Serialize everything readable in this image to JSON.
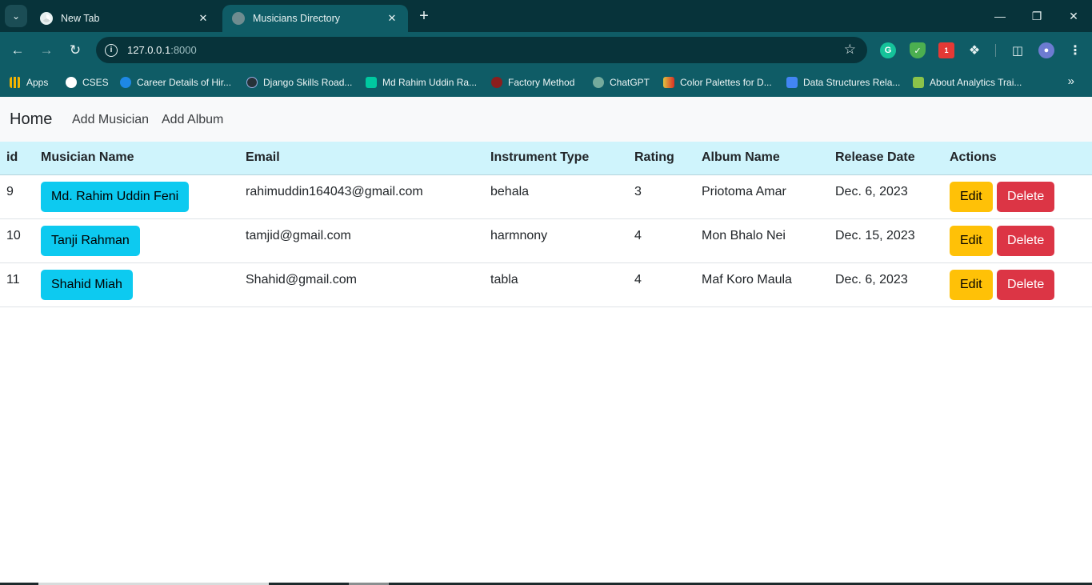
{
  "browser": {
    "tabs": [
      {
        "title": "New Tab",
        "active": false
      },
      {
        "title": "Musicians Directory",
        "active": true
      }
    ],
    "url_host": "127.0.0.1",
    "url_port": ":8000",
    "bookmarks": [
      {
        "label": "Apps",
        "icon_color": "#f4b400"
      },
      {
        "label": "CSES",
        "icon_color": "#ffffff"
      },
      {
        "label": "Career Details of Hir...",
        "icon_color": "#1e88e5"
      },
      {
        "label": "Django Skills Road...",
        "icon_color": "#263238"
      },
      {
        "label": "Md Rahim Uddin Ra...",
        "icon_color": "#00c8a0"
      },
      {
        "label": "Factory Method",
        "icon_color": "#8b1e1e"
      },
      {
        "label": "ChatGPT",
        "icon_color": "#74aa9c"
      },
      {
        "label": "Color Palettes for D...",
        "icon_color": "#e0c240"
      },
      {
        "label": "Data Structures Rela...",
        "icon_color": "#4285f4"
      },
      {
        "label": "About Analytics Trai...",
        "icon_color": "#8bc34a"
      }
    ],
    "extension_badge": "1"
  },
  "nav": {
    "brand": "Home",
    "links": [
      "Add Musician",
      "Add Album"
    ]
  },
  "table": {
    "headers": [
      "id",
      "Musician Name",
      "Email",
      "Instrument Type",
      "Rating",
      "Album Name",
      "Release Date",
      "Actions"
    ],
    "rows": [
      {
        "id": "9",
        "name": "Md. Rahim Uddin Feni",
        "email": "rahimuddin164043@gmail.com",
        "instrument": "behala",
        "rating": "3",
        "album": "Priotoma Amar",
        "release": "Dec. 6, 2023"
      },
      {
        "id": "10",
        "name": "Tanji Rahman",
        "email": "tamjid@gmail.com",
        "instrument": "harmnony",
        "rating": "4",
        "album": "Mon Bhalo Nei",
        "release": "Dec. 15, 2023"
      },
      {
        "id": "11",
        "name": "Shahid Miah",
        "email": "Shahid@gmail.com",
        "instrument": "tabla",
        "rating": "4",
        "album": "Maf Koro Maula",
        "release": "Dec. 6, 2023"
      }
    ],
    "edit_label": "Edit",
    "delete_label": "Delete"
  },
  "colors": {
    "chrome_dark": "#07333a",
    "chrome_teal": "#0f5c66",
    "header_bg": "#cff4fc",
    "info": "#0dcaf0",
    "warning": "#ffc107",
    "danger": "#dc3545"
  }
}
